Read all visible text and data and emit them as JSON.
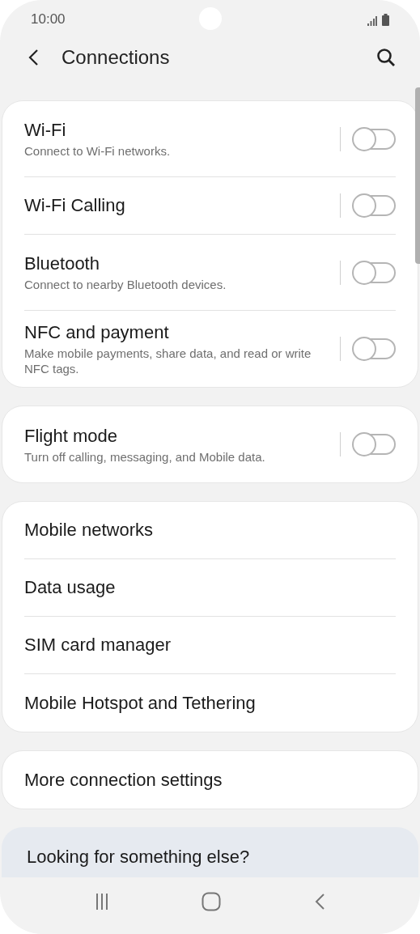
{
  "status_bar": {
    "time": "10:00"
  },
  "header": {
    "title": "Connections"
  },
  "groups": [
    {
      "items": [
        {
          "title": "Wi-Fi",
          "subtitle": "Connect to Wi-Fi networks.",
          "kind": "toggle",
          "on": false
        },
        {
          "title": "Wi-Fi Calling",
          "kind": "toggle",
          "on": false
        },
        {
          "title": "Bluetooth",
          "subtitle": "Connect to nearby Bluetooth devices.",
          "kind": "toggle",
          "on": false
        },
        {
          "title": "NFC and payment",
          "subtitle": "Make mobile payments, share data, and read or write NFC tags.",
          "kind": "toggle",
          "on": false
        }
      ]
    },
    {
      "items": [
        {
          "title": "Flight mode",
          "subtitle": "Turn off calling, messaging, and Mobile data.",
          "kind": "toggle",
          "on": false
        }
      ]
    },
    {
      "items": [
        {
          "title": "Mobile networks",
          "kind": "link"
        },
        {
          "title": "Data usage",
          "kind": "link"
        },
        {
          "title": "SIM card manager",
          "kind": "link"
        },
        {
          "title": "Mobile Hotspot and Tethering",
          "kind": "link"
        }
      ]
    },
    {
      "items": [
        {
          "title": "More connection settings",
          "kind": "link"
        }
      ]
    }
  ],
  "suggestion": {
    "title": "Looking for something else?"
  }
}
